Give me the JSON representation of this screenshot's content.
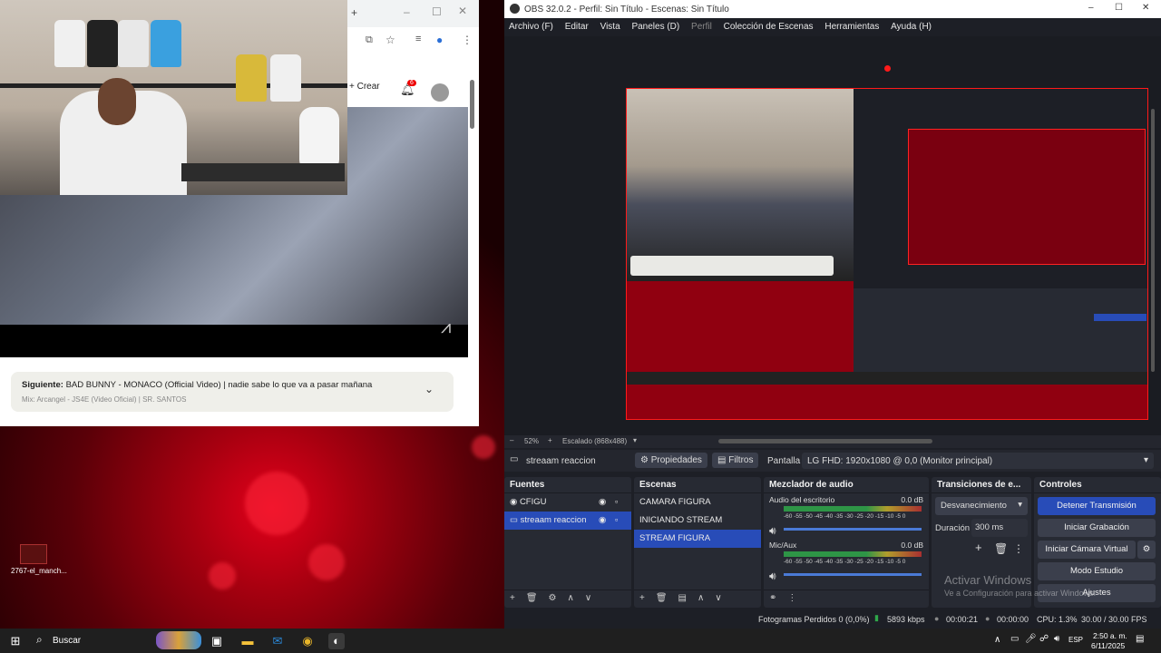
{
  "desktop": {
    "icon_label": "2767-el_manch..."
  },
  "browser": {
    "create_label": "Crear",
    "notif_count": "6",
    "next_label": "Siguiente:",
    "next_title": "BAD BUNNY - MONACO (Official Video) | nadie sabe lo que va a pasar mañana",
    "mix_line": "Mix: Arcangel - JS4E (Video Oficial) | SR. SANTOS"
  },
  "obs": {
    "title": "OBS 32.0.2 - Perfil: Sin Título - Escenas: Sin Título",
    "menu": [
      "Archivo (F)",
      "Editar",
      "Vista",
      "Paneles (D)",
      "Perfil",
      "Colección de Escenas",
      "Herramientas",
      "Ayuda (H)"
    ],
    "zoom": "52%",
    "scaling": "Escalado (868x488)",
    "selected_source": "streaam reaccion",
    "properties_label": "Propiedades",
    "filters_label": "Filtros",
    "display_label": "Pantalla",
    "display_value": "LG FHD: 1920x1080 @ 0,0 (Monitor principal)",
    "sources": {
      "title": "Fuentes",
      "items": [
        "CFIGU",
        "streaam reaccion"
      ]
    },
    "scenes": {
      "title": "Escenas",
      "items": [
        "CAMARA FIGURA",
        "INICIANDO STREAM",
        "STREAM FIGURA"
      ]
    },
    "mixer": {
      "title": "Mezclador de audio",
      "ch1_name": "Audio del escritorio",
      "ch1_db": "0.0 dB",
      "ch2_name": "Mic/Aux",
      "ch2_db": "0.0 dB",
      "scale": "-60 -55 -50 -45 -40 -35 -30 -25 -20 -15 -10 -5 0"
    },
    "transitions": {
      "title": "Transiciones de e...",
      "type": "Desvanecimiento",
      "duration_label": "Duración",
      "duration_value": "300 ms"
    },
    "controls": {
      "title": "Controles",
      "stop_stream": "Detener Transmisión",
      "start_rec": "Iniciar Grabación",
      "start_vcam": "Iniciar Cámara Virtual",
      "studio": "Modo Estudio",
      "settings": "Ajustes"
    },
    "activate": {
      "line1": "Activar Windows",
      "line2": "Ve a Configuración para activar Windows."
    },
    "status": {
      "dropped": "Fotogramas Perdidos 0 (0,0%)",
      "bitrate": "5893 kbps",
      "time": "00:00:21",
      "rec_time": "00:00:00",
      "cpu": "CPU: 1.3%",
      "fps": "30.00 / 30.00 FPS"
    }
  },
  "taskbar": {
    "search": "Buscar",
    "lang": "ESP",
    "time": "2:50 a. m.",
    "date": "6/11/2025"
  },
  "colors": {
    "obs_accent": "#284cb8",
    "live_red": "#e3001b"
  }
}
